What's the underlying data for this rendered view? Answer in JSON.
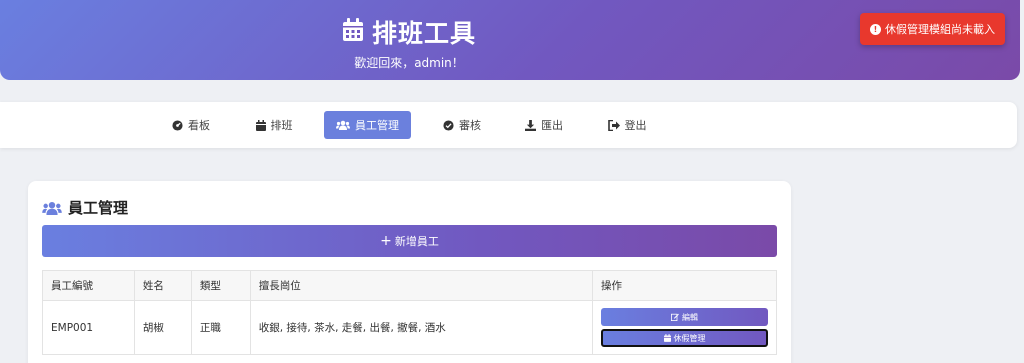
{
  "header": {
    "title": "排班工具",
    "icon": "calendar-icon",
    "welcome": "歡迎回來，admin！"
  },
  "toast": {
    "message": "休假管理模組尚未載入",
    "color": "#e8382d"
  },
  "nav": {
    "items": [
      {
        "label": "看板",
        "icon": "dashboard-icon"
      },
      {
        "label": "排班",
        "icon": "calendar-icon"
      },
      {
        "label": "員工管理",
        "icon": "users-icon",
        "active": true
      },
      {
        "label": "審核",
        "icon": "check-circle-icon"
      },
      {
        "label": "匯出",
        "icon": "download-icon"
      },
      {
        "label": "登出",
        "icon": "sign-out-icon"
      }
    ]
  },
  "employee_section": {
    "title": "員工管理",
    "add_button": "新增員工",
    "table": {
      "headers": [
        "員工編號",
        "姓名",
        "類型",
        "擅長崗位",
        "操作"
      ],
      "rows": [
        {
          "id": "EMP001",
          "name": "胡椒",
          "type": "正職",
          "skills": "收銀, 接待, 茶水, 走餐, 出餐, 撤餐, 酒水",
          "edit_label": "編輯",
          "leave_label": "休假管理"
        }
      ]
    }
  },
  "colors": {
    "accent": "#6b80dd",
    "gradient_end": "#7a4aa8"
  }
}
